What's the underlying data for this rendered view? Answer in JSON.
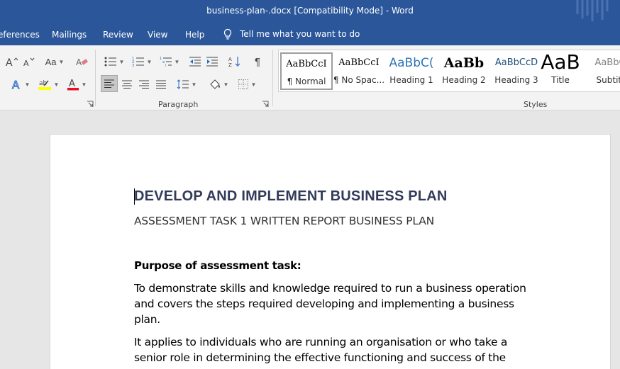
{
  "window": {
    "title": "business-plan-.docx [Compatibility Mode]  -  Word"
  },
  "menu": {
    "tabs": [
      "eferences",
      "Mailings",
      "Review",
      "View",
      "Help"
    ],
    "tell_me": "Tell me what you want to do"
  },
  "ribbon": {
    "font_group": {
      "change_case_label": "Aa"
    },
    "paragraph_group": {
      "label": "Paragraph"
    },
    "styles_group": {
      "label": "Styles",
      "items": [
        {
          "preview": "AaBbCcI",
          "name": "¶ Normal"
        },
        {
          "preview": "AaBbCcI",
          "name": "¶ No Spac..."
        },
        {
          "preview": "AaBbC(",
          "name": "Heading 1"
        },
        {
          "preview": "AaBb",
          "name": "Heading 2"
        },
        {
          "preview": "AaBbCcD",
          "name": "Heading 3"
        },
        {
          "preview": "AaB",
          "name": "Title"
        },
        {
          "preview": "AaBbC",
          "name": "Subtitl"
        }
      ]
    }
  },
  "document": {
    "heading": "DEVELOP AND IMPLEMENT BUSINESS PLAN",
    "subheading": "ASSESSMENT TASK 1 WRITTEN REPORT BUSINESS PLAN",
    "purpose_label": "Purpose of assessment task:",
    "paragraph1": "To demonstrate skills and knowledge required to run a business operation and covers the steps required developing and implementing a business plan.",
    "paragraph2": "It applies to individuals who are running an organisation or who take a senior role in determining the effective functioning and success of the"
  },
  "colors": {
    "accent": "#2b579a",
    "heading_text": "#323b5a",
    "ribbon_bg": "#f3f3f3"
  }
}
